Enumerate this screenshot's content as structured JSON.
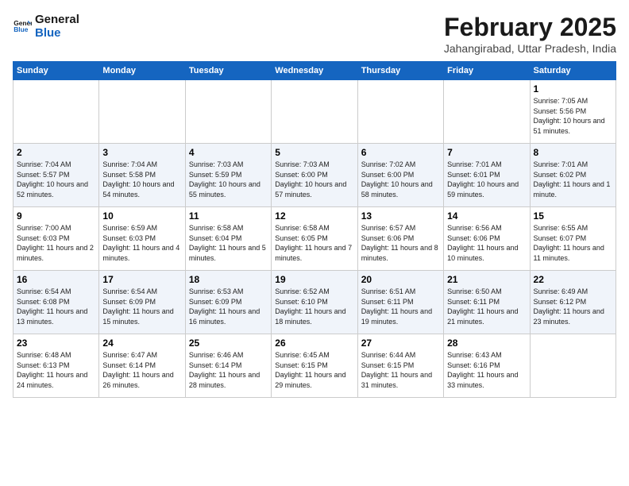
{
  "header": {
    "logo_line1": "General",
    "logo_line2": "Blue",
    "title": "February 2025",
    "subtitle": "Jahangirabad, Uttar Pradesh, India"
  },
  "days_of_week": [
    "Sunday",
    "Monday",
    "Tuesday",
    "Wednesday",
    "Thursday",
    "Friday",
    "Saturday"
  ],
  "weeks": [
    [
      {
        "day": "",
        "info": ""
      },
      {
        "day": "",
        "info": ""
      },
      {
        "day": "",
        "info": ""
      },
      {
        "day": "",
        "info": ""
      },
      {
        "day": "",
        "info": ""
      },
      {
        "day": "",
        "info": ""
      },
      {
        "day": "1",
        "info": "Sunrise: 7:05 AM\nSunset: 5:56 PM\nDaylight: 10 hours and 51 minutes."
      }
    ],
    [
      {
        "day": "2",
        "info": "Sunrise: 7:04 AM\nSunset: 5:57 PM\nDaylight: 10 hours and 52 minutes."
      },
      {
        "day": "3",
        "info": "Sunrise: 7:04 AM\nSunset: 5:58 PM\nDaylight: 10 hours and 54 minutes."
      },
      {
        "day": "4",
        "info": "Sunrise: 7:03 AM\nSunset: 5:59 PM\nDaylight: 10 hours and 55 minutes."
      },
      {
        "day": "5",
        "info": "Sunrise: 7:03 AM\nSunset: 6:00 PM\nDaylight: 10 hours and 57 minutes."
      },
      {
        "day": "6",
        "info": "Sunrise: 7:02 AM\nSunset: 6:00 PM\nDaylight: 10 hours and 58 minutes."
      },
      {
        "day": "7",
        "info": "Sunrise: 7:01 AM\nSunset: 6:01 PM\nDaylight: 10 hours and 59 minutes."
      },
      {
        "day": "8",
        "info": "Sunrise: 7:01 AM\nSunset: 6:02 PM\nDaylight: 11 hours and 1 minute."
      }
    ],
    [
      {
        "day": "9",
        "info": "Sunrise: 7:00 AM\nSunset: 6:03 PM\nDaylight: 11 hours and 2 minutes."
      },
      {
        "day": "10",
        "info": "Sunrise: 6:59 AM\nSunset: 6:03 PM\nDaylight: 11 hours and 4 minutes."
      },
      {
        "day": "11",
        "info": "Sunrise: 6:58 AM\nSunset: 6:04 PM\nDaylight: 11 hours and 5 minutes."
      },
      {
        "day": "12",
        "info": "Sunrise: 6:58 AM\nSunset: 6:05 PM\nDaylight: 11 hours and 7 minutes."
      },
      {
        "day": "13",
        "info": "Sunrise: 6:57 AM\nSunset: 6:06 PM\nDaylight: 11 hours and 8 minutes."
      },
      {
        "day": "14",
        "info": "Sunrise: 6:56 AM\nSunset: 6:06 PM\nDaylight: 11 hours and 10 minutes."
      },
      {
        "day": "15",
        "info": "Sunrise: 6:55 AM\nSunset: 6:07 PM\nDaylight: 11 hours and 11 minutes."
      }
    ],
    [
      {
        "day": "16",
        "info": "Sunrise: 6:54 AM\nSunset: 6:08 PM\nDaylight: 11 hours and 13 minutes."
      },
      {
        "day": "17",
        "info": "Sunrise: 6:54 AM\nSunset: 6:09 PM\nDaylight: 11 hours and 15 minutes."
      },
      {
        "day": "18",
        "info": "Sunrise: 6:53 AM\nSunset: 6:09 PM\nDaylight: 11 hours and 16 minutes."
      },
      {
        "day": "19",
        "info": "Sunrise: 6:52 AM\nSunset: 6:10 PM\nDaylight: 11 hours and 18 minutes."
      },
      {
        "day": "20",
        "info": "Sunrise: 6:51 AM\nSunset: 6:11 PM\nDaylight: 11 hours and 19 minutes."
      },
      {
        "day": "21",
        "info": "Sunrise: 6:50 AM\nSunset: 6:11 PM\nDaylight: 11 hours and 21 minutes."
      },
      {
        "day": "22",
        "info": "Sunrise: 6:49 AM\nSunset: 6:12 PM\nDaylight: 11 hours and 23 minutes."
      }
    ],
    [
      {
        "day": "23",
        "info": "Sunrise: 6:48 AM\nSunset: 6:13 PM\nDaylight: 11 hours and 24 minutes."
      },
      {
        "day": "24",
        "info": "Sunrise: 6:47 AM\nSunset: 6:14 PM\nDaylight: 11 hours and 26 minutes."
      },
      {
        "day": "25",
        "info": "Sunrise: 6:46 AM\nSunset: 6:14 PM\nDaylight: 11 hours and 28 minutes."
      },
      {
        "day": "26",
        "info": "Sunrise: 6:45 AM\nSunset: 6:15 PM\nDaylight: 11 hours and 29 minutes."
      },
      {
        "day": "27",
        "info": "Sunrise: 6:44 AM\nSunset: 6:15 PM\nDaylight: 11 hours and 31 minutes."
      },
      {
        "day": "28",
        "info": "Sunrise: 6:43 AM\nSunset: 6:16 PM\nDaylight: 11 hours and 33 minutes."
      },
      {
        "day": "",
        "info": ""
      }
    ]
  ]
}
